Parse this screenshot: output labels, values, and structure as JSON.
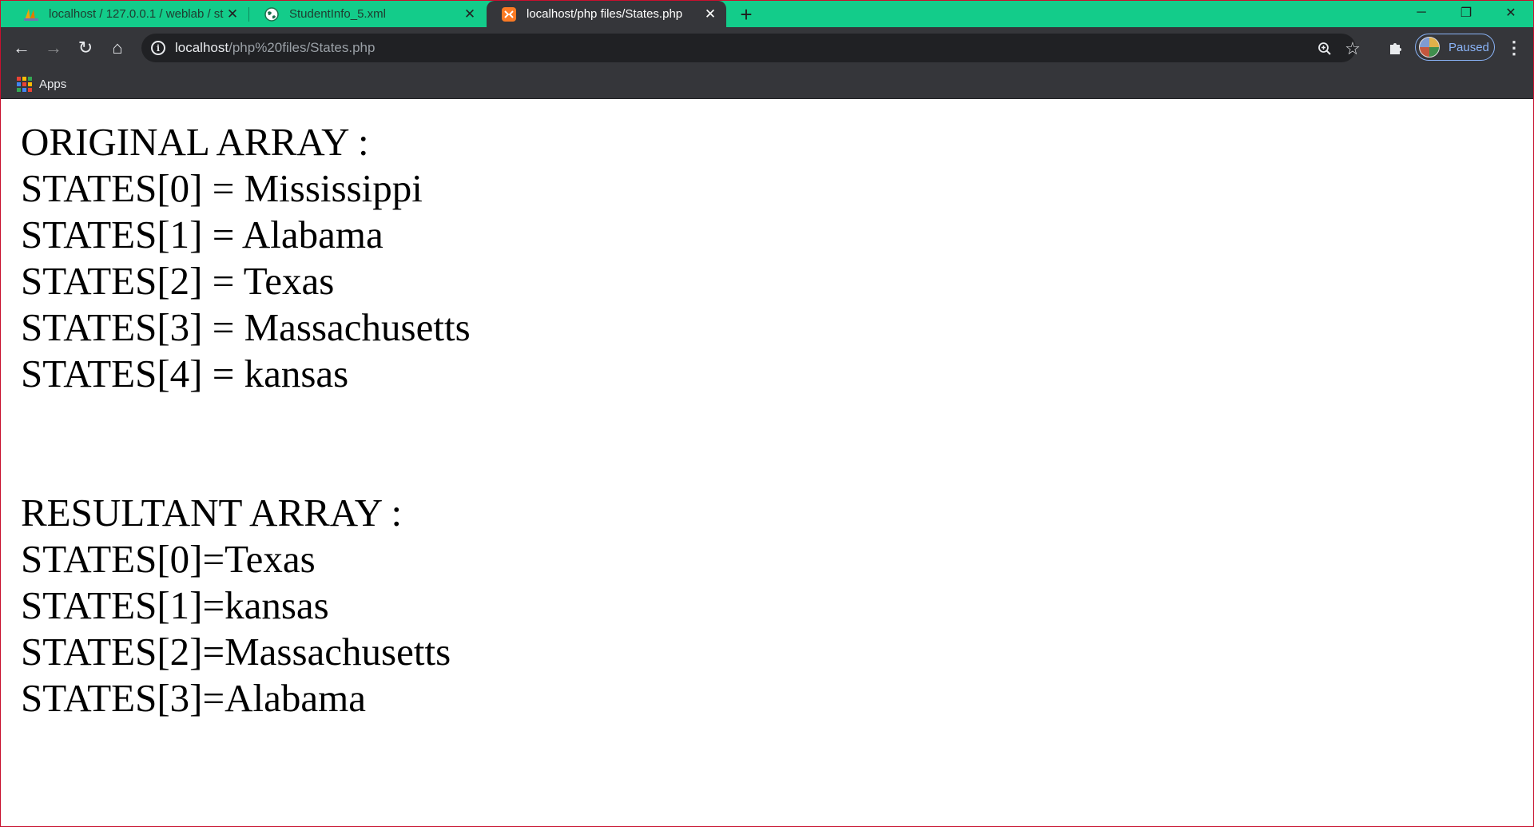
{
  "tabs": [
    {
      "title": "localhost / 127.0.0.1 / weblab / st",
      "favicon": "phpmyadmin-icon",
      "active": false
    },
    {
      "title": "StudentInfo_5.xml",
      "favicon": "globe-icon",
      "active": false
    },
    {
      "title": "localhost/php files/States.php",
      "favicon": "xampp-icon",
      "active": true
    }
  ],
  "tab_close_glyph": "✕",
  "new_tab_glyph": "+",
  "window_controls": {
    "minimize": "─",
    "restore": "❐",
    "close": "✕"
  },
  "nav": {
    "back": "←",
    "forward": "→",
    "reload": "↻",
    "home": "⌂"
  },
  "address": {
    "host": "localhost",
    "path": "/php%20files/States.php"
  },
  "toolbar_icons": {
    "zoom": "zoom-icon",
    "bookmark_star": "☆",
    "extensions": "puzzle-icon",
    "menu": "⋮"
  },
  "profile": {
    "status": "Paused"
  },
  "bookmarks_bar": {
    "apps_label": "Apps"
  },
  "apps_colors": [
    "#ea4335",
    "#fbbc04",
    "#34a853",
    "#4285f4",
    "#ea4335",
    "#fbbc04",
    "#34a853",
    "#4285f4",
    "#ea4335"
  ],
  "colors": {
    "titlebar": "#13cc8a",
    "toolbar": "#35363a",
    "omnibox": "#202124",
    "accent": "#8ab4f8"
  },
  "page": {
    "original_heading": "ORIGINAL ARRAY :",
    "original_lines": [
      "STATES[0] = Mississippi",
      "STATES[1] = Alabama",
      "STATES[2] = Texas",
      "STATES[3] = Massachusetts",
      "STATES[4] = kansas"
    ],
    "resultant_heading": "RESULTANT ARRAY :",
    "resultant_lines": [
      "STATES[0]=Texas",
      "STATES[1]=kansas",
      "STATES[2]=Massachusetts",
      "STATES[3]=Alabama"
    ]
  }
}
